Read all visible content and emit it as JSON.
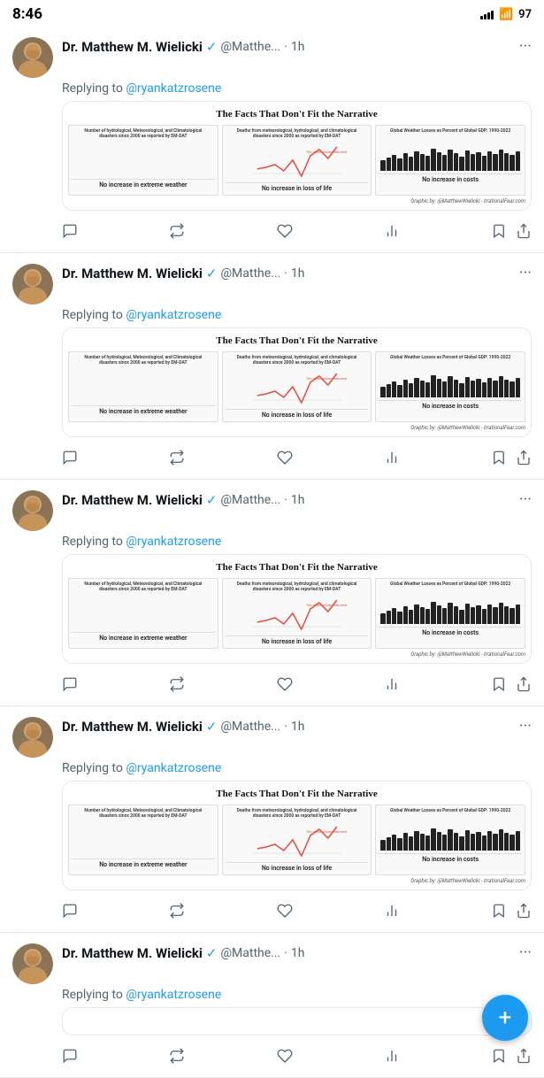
{
  "statusBar": {
    "time": "8:46",
    "battery": "97",
    "batteryIcon": "97"
  },
  "tweets": [
    {
      "id": "tweet-1",
      "author": "Dr. Matthew M. Wielicki",
      "handle": "@Matthe...",
      "time": "1h",
      "replyTo": "@ryankatzrosene",
      "chartTitle": "The Facts That Don't Fit the Narrative",
      "panel1Label": "No increase in extreme weather",
      "panel2Label": "No increase in loss of life",
      "panel3Label": "No increase in costs",
      "caption": "Graphic by: @MatthewWielicki - IrrationalFear.com"
    },
    {
      "id": "tweet-2",
      "author": "Dr. Matthew M. Wielicki",
      "handle": "@Matthe...",
      "time": "1h",
      "replyTo": "@ryankatzrosene",
      "chartTitle": "The Facts That Don't Fit the Narrative",
      "panel1Label": "No increase in extreme weather",
      "panel2Label": "No increase in loss of life",
      "panel3Label": "No increase in costs",
      "caption": "Graphic by: @MatthewWielicki - IrrationalFear.com"
    },
    {
      "id": "tweet-3",
      "author": "Dr. Matthew M. Wielicki",
      "handle": "@Matthe...",
      "time": "1h",
      "replyTo": "@ryankatzrosene",
      "chartTitle": "The Facts That Don't Fit the Narrative",
      "panel1Label": "No increase in extreme weather",
      "panel2Label": "No increase in loss of life",
      "panel3Label": "No increase in costs",
      "caption": "Graphic by: @MatthewWielicki - IrrationalFear.com"
    },
    {
      "id": "tweet-4",
      "author": "Dr. Matthew M. Wielicki",
      "handle": "@Matthe...",
      "time": "1h",
      "replyTo": "@ryankatzrosene",
      "chartTitle": "The Facts That Don't Fit the Narrative",
      "panel1Label": "No increase in extreme weather",
      "panel2Label": "No increase in loss of life",
      "panel3Label": "No increase in costs",
      "caption": "Graphic by: @MatthewWielicki - IrrationalFear.com"
    },
    {
      "id": "tweet-5",
      "author": "Dr. Matthew M. Wielicki",
      "handle": "@Matthe...",
      "time": "1h",
      "replyTo": "@ryankatzrosene",
      "chartTitle": "",
      "panel1Label": "",
      "panel2Label": "",
      "panel3Label": "",
      "caption": "",
      "partial": true
    }
  ],
  "actions": {
    "reply": "",
    "retweet": "",
    "like": "",
    "views": "",
    "bookmark": "",
    "share": ""
  },
  "fab": {
    "label": "+"
  }
}
